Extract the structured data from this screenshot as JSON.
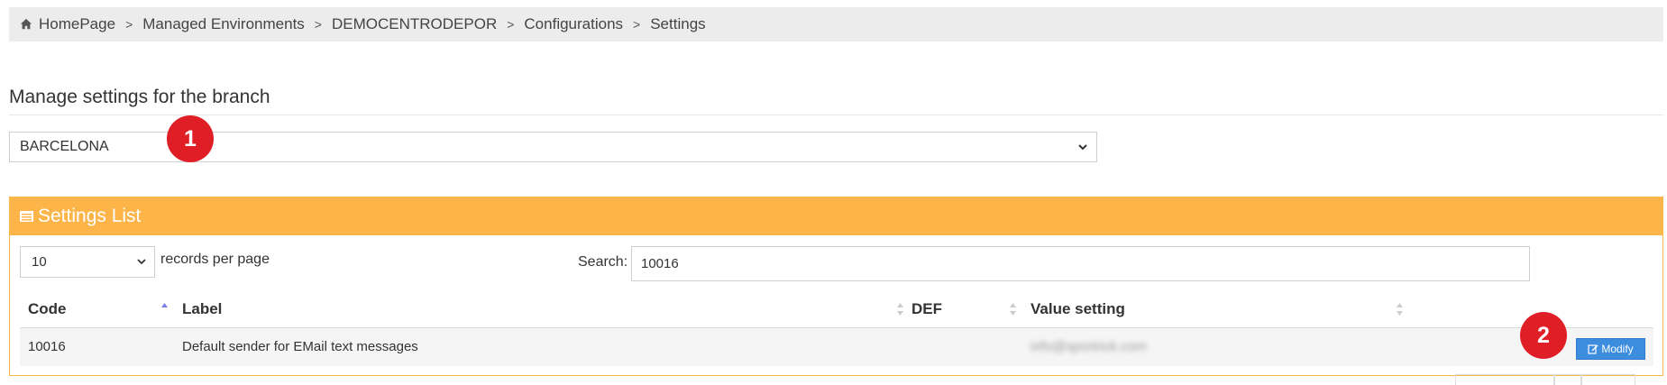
{
  "breadcrumb": {
    "items": [
      "HomePage",
      "Managed Environments",
      "DEMOCENTRODEPOR",
      "Configurations",
      "Settings"
    ],
    "separator": ">",
    "home_icon": "home-icon"
  },
  "section": {
    "title": "Manage settings for the branch"
  },
  "branch_select": {
    "value": "BARCELONA"
  },
  "badges": {
    "one": "1",
    "two": "2"
  },
  "settings_panel": {
    "title": "Settings List",
    "page_length": "10",
    "page_length_suffix": "records per page",
    "search_label": "Search:",
    "search_value": "10016",
    "columns": [
      "Code",
      "Label",
      "DEF",
      "Value setting"
    ],
    "rows": [
      {
        "code": "10016",
        "label": "Default sender for EMail text messages",
        "def": "",
        "value": "info@sportrick.com",
        "action": "Modify"
      }
    ]
  },
  "colors": {
    "panel_header": "#fdb54a",
    "badge": "#e01e26",
    "modify_button": "#3c8dde",
    "breadcrumb_bg": "#ececec"
  }
}
